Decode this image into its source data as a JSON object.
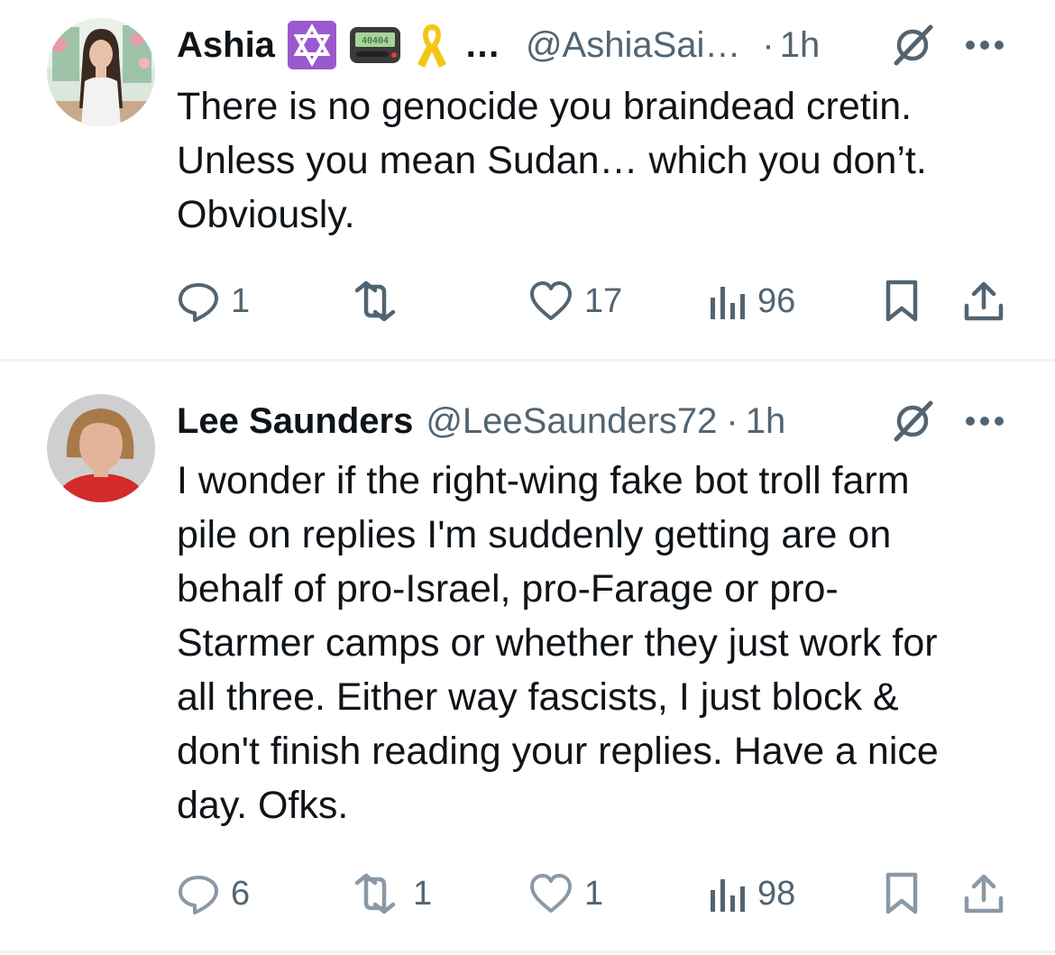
{
  "tweets": [
    {
      "name": "Ashia",
      "handle": "@AshiaSai…",
      "dot": "·",
      "time": "1h",
      "ellipsis": "…",
      "badge_text": "40404",
      "badge_icons": [
        "star-of-david-icon",
        "pager-icon",
        "yellow-ribbon-icon"
      ],
      "text_lines": [
        "There is no genocide you braindead cretin.",
        "Unless you mean Sudan… which you don’t.",
        "Obviously."
      ],
      "replies": "1",
      "reposts": "",
      "likes": "17",
      "views": "96"
    },
    {
      "name": "Lee Saunders",
      "handle": "@LeeSaunders72",
      "dot": "·",
      "time": "1h",
      "text_lines": [
        "I wonder if the right-wing fake bot troll farm",
        "pile on replies I'm suddenly getting are on",
        "behalf of pro-Israel, pro-Farage or pro-",
        "Starmer camps or whether they just work for",
        "all three. Either way fascists, I just block &",
        "don't finish reading your replies. Have a nice",
        "day. Ofks."
      ],
      "replies": "6",
      "reposts": "1",
      "likes": "1",
      "views": "98"
    }
  ],
  "colors": {
    "text": "#0f1419",
    "secondary": "#536471",
    "divider": "#eff3f4",
    "star_badge": "#9b59d0",
    "ribbon": "#f5c518"
  }
}
